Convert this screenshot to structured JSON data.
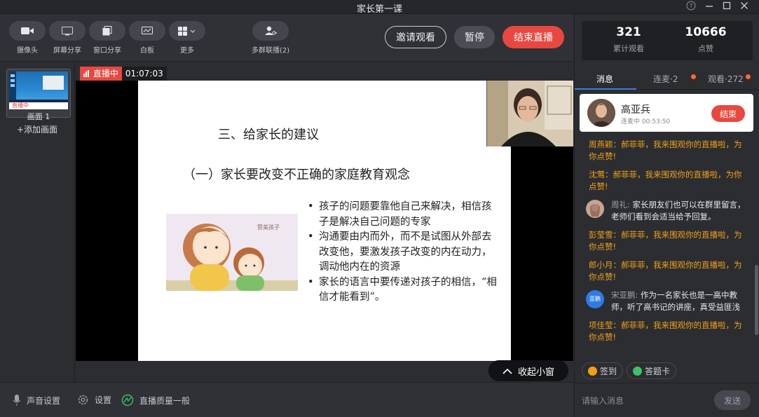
{
  "window": {
    "title": "家长第一课"
  },
  "toolbar": {
    "tools": [
      {
        "label": "摄像头",
        "icon": "camera-icon"
      },
      {
        "label": "屏幕分享",
        "icon": "screen-share-icon"
      },
      {
        "label": "窗口分享",
        "icon": "window-share-icon"
      },
      {
        "label": "白板",
        "icon": "whiteboard-icon"
      },
      {
        "label": "更多",
        "icon": "grid-icon"
      },
      {
        "label": "多群联播(2)",
        "icon": "multi-group-icon"
      }
    ],
    "invite_label": "邀请观看",
    "pause_label": "暂停",
    "end_label": "结束直播"
  },
  "scenes": {
    "thumb_live": "直播中",
    "scene_name": "画面 1",
    "add_label": "+添加画面"
  },
  "stage": {
    "live_label": "直播中",
    "elapsed": "01:07:03",
    "slide": {
      "title": "三、给家长的建议",
      "subtitle": "（一）家长要改变不正确的家庭教育观念",
      "art_tag": "赞美孩子",
      "bullets": [
        "孩子的问题要靠他自己来解决，相信孩子是解决自己问题的专家",
        "沟通要由内而外，而不是试图从外部去改变他，要激发孩子改变的内在动力，调动他内在的资源",
        "家长的语言中要传递对孩子的相信，“相信才能看到”。"
      ]
    },
    "collapse_label": "收起小窗"
  },
  "bottombar": {
    "sound_label": "声音设置",
    "settings_label": "设置",
    "quality_label": "直播质量一般"
  },
  "right": {
    "stats": {
      "views": "321",
      "views_label": "累计观看",
      "likes": "10666",
      "likes_label": "点赞"
    },
    "tabs": {
      "messages": "消息",
      "mic": "连麦·2",
      "viewers": "观看·272"
    },
    "mic_card": {
      "name": "高亚兵",
      "status": "连麦中 00:53:50",
      "end_label": "结束"
    },
    "messages": [
      {
        "type": "sys",
        "text": "周燕颖：郝菲菲，我来围观你的直播啦，为你点赞!"
      },
      {
        "type": "sys",
        "text": "沈莺：郝菲菲，我来围观你的直播啦，为你点赞!"
      },
      {
        "type": "user",
        "who": "周礼:",
        "text": " 家长朋友们也可以在群里留言，老师们看到会适当给予回复。",
        "avatar_color": "#b48a7a",
        "avatar_text": ""
      },
      {
        "type": "sys",
        "text": "彭莹雪：郝菲菲，我来围观你的直播啦，为你点赞!"
      },
      {
        "type": "sys",
        "text": "郎小月：郝菲菲，我来围观你的直播啦，为你点赞!"
      },
      {
        "type": "user",
        "who": "宋亚鹏:",
        "text": " 作为一名家长也是一高中教师，听了高书记的讲座，真受益匪浅",
        "avatar_color": "#2f7be5",
        "avatar_text": "亚鹏"
      },
      {
        "type": "sys",
        "text": "项佳莹：郝菲菲，我来围观你的直播啦，为你点赞!"
      }
    ],
    "tools": {
      "signin_label": "签到",
      "answer_label": "答题卡"
    },
    "input": {
      "placeholder": "请输入消息",
      "send_label": "发送"
    }
  }
}
